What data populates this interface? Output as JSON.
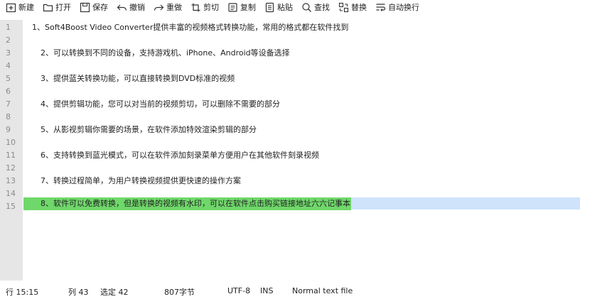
{
  "toolbar": {
    "new_label": "新建",
    "open_label": "打开",
    "save_label": "保存",
    "undo_label": "撤销",
    "redo_label": "重做",
    "cut_label": "剪切",
    "copy_label": "复制",
    "paste_label": "粘贴",
    "find_label": "查找",
    "replace_label": "替换",
    "wrap_label": "自动换行"
  },
  "editor": {
    "line_numbers": [
      "1",
      "2",
      "3",
      "4",
      "5",
      "6",
      "7",
      "8",
      "9",
      "10",
      "11",
      "12",
      "13",
      "14",
      "15"
    ],
    "lines": [
      "1、Soft4Boost Video Converter提供丰富的视频格式转换功能，常用的格式都在软件找到",
      "",
      "2、可以转换到不同的设备，支持游戏机、iPhone、Android等设备选择",
      "",
      "3、提供蓝关转换功能，可以直接转换到DVD标准的视频",
      "",
      "4、提供剪辑功能，您可以对当前的视频剪切，可以删除不需要的部分",
      "",
      "5、从影视剪辑你需要的场景，在软件添加特效渲染剪辑的部分",
      "",
      "6、支持转换到蓝光模式，可以在软件添加刻录菜单方便用户在其他软件刻录视频",
      "",
      "7、转换过程简单，为用户转换视频提供更快速的操作方案",
      "",
      "8、软件可以免费转换，但是转换的视频有水印，可以在软件点击购买链接地址六六记事本"
    ],
    "selected_line": 15
  },
  "status": {
    "position": "行 15:15",
    "column": "列 43",
    "selection": "选定 42",
    "bytes": "807字节",
    "encoding": "UTF-8",
    "mode": "INS",
    "filetype": "Normal text file"
  },
  "colors": {
    "gutter": "#e6e6e6",
    "current_line": "#cfe3fb",
    "selection": "#6fd86a"
  }
}
